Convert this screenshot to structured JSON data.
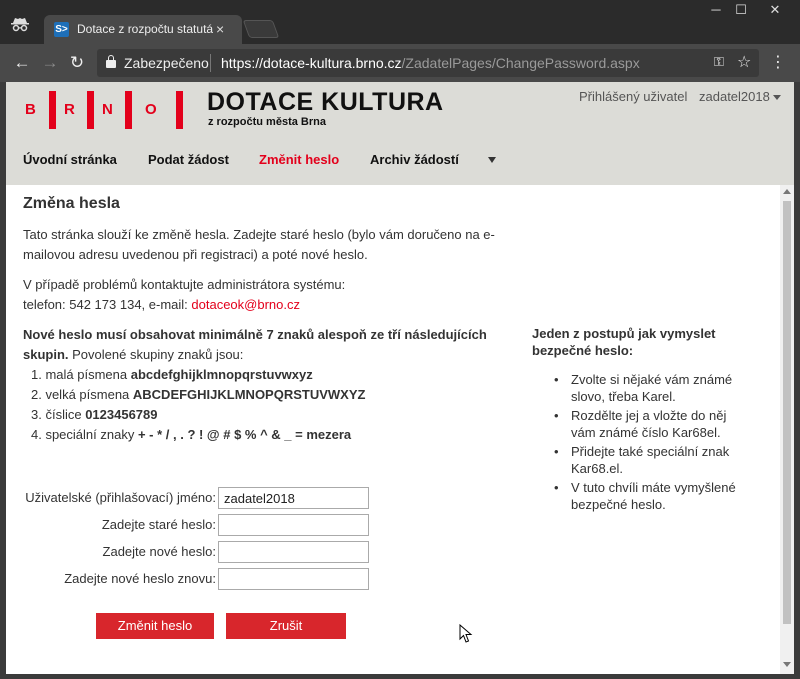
{
  "browser": {
    "tab_title": "Dotace z rozpočtu statutárního",
    "tab_icon": "S>",
    "security_label": "Zabezpečeno",
    "url_host": "https://dotace-kultura.brno.cz",
    "url_path": "/ZadatelPages/ChangePassword.aspx"
  },
  "header": {
    "logo_letters": [
      "B",
      "R",
      "N",
      "O"
    ],
    "title": "DOTACE KULTURA",
    "subtitle": "z rozpočtu města Brna",
    "user_label": "Přihlášený uživatel",
    "user_name": "zadatel2018"
  },
  "nav": {
    "items": [
      {
        "label": "Úvodní stránka"
      },
      {
        "label": "Podat žádost"
      },
      {
        "label": "Změnit heslo"
      },
      {
        "label": "Archiv žádostí"
      }
    ]
  },
  "main": {
    "heading": "Změna hesla",
    "intro_line1": "Tato stránka slouží ke změně hesla. Zadejte staré heslo (bylo vám doručeno na e-",
    "intro_line2": "mailovou adresu uvedenou při registraci) a poté nové heslo.",
    "contact_line1": "V případě problémů kontaktujte administrátora systému:",
    "contact_phone": "telefon: 542 173 134, e-mail: ",
    "contact_email": "dotaceok@brno.cz",
    "rule_line1": "Nové heslo musí obsahovat minimálně 7 znaků alespoň ze tří následujících",
    "rule_line2_bold": "skupin.",
    "rule_line2_rest": " Povolené skupiny znaků jsou:",
    "groups": [
      {
        "prefix": "1. malá písmena ",
        "chars": "abcdefghijklmnopqrstuvwxyz"
      },
      {
        "prefix": "2. velká písmena ",
        "chars": "ABCDEFGHIJKLMNOPQRSTUVWXYZ"
      },
      {
        "prefix": "3. číslice ",
        "chars": "0123456789"
      },
      {
        "prefix": "4. speciální znaky ",
        "chars": "+ - * / , . ? ! @ # $ % ^ & _ = mezera"
      }
    ]
  },
  "tips": {
    "heading": "Jeden z postupů jak vymyslet bezpečné heslo:",
    "items": [
      "Zvolte si nějaké vám známé slovo, třeba Karel.",
      "Rozdělte jej a vložte do něj vám známé číslo Kar68el.",
      "Přidejte také speciální znak Kar68.el.",
      "V tuto chvíli máte vymyšlené bezpečné heslo."
    ]
  },
  "form": {
    "username_label": "Uživatelské (přihlašovací) jméno:",
    "username_value": "zadatel2018",
    "old_password_label": "Zadejte staré heslo:",
    "new_password_label": "Zadejte nové heslo:",
    "new_password_again_label": "Zadejte nové heslo znovu:",
    "submit_label": "Změnit heslo",
    "cancel_label": "Zrušit"
  },
  "colors": {
    "brand_red": "#e3001b",
    "button_red": "#d8262c",
    "header_bg": "#dcdcd7"
  }
}
